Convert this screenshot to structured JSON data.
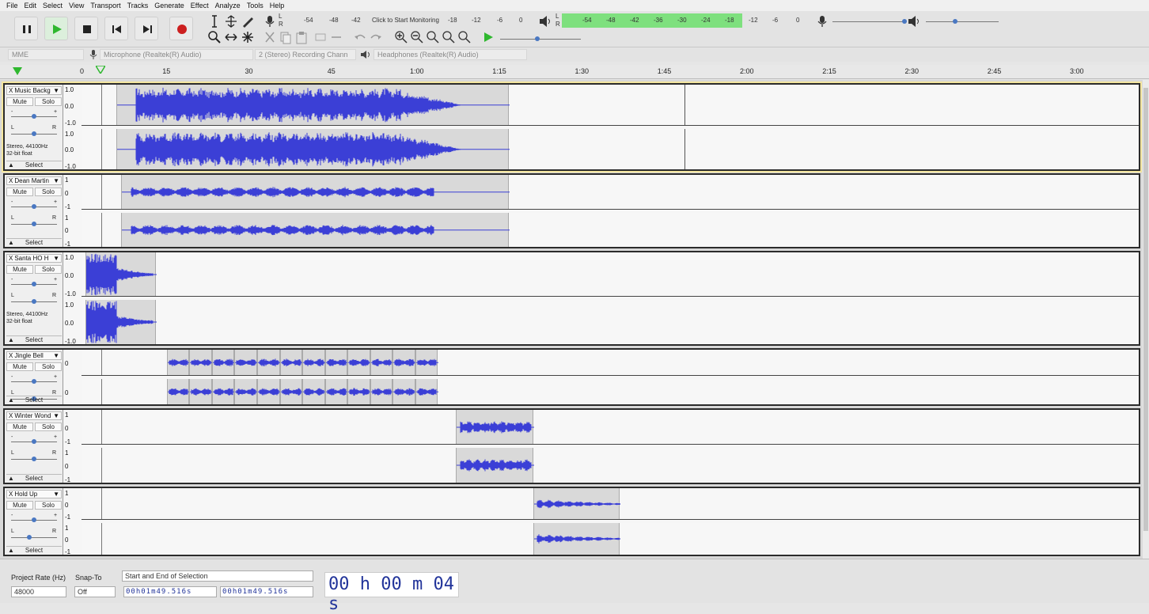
{
  "menus": [
    "File",
    "Edit",
    "Select",
    "View",
    "Transport",
    "Tracks",
    "Generate",
    "Effect",
    "Analyze",
    "Tools",
    "Help"
  ],
  "transport": {
    "pause": "pause-icon",
    "play": "play-icon",
    "stop": "stop-icon",
    "skip_start": "skip-start-icon",
    "skip_end": "skip-end-icon",
    "record": "record-icon"
  },
  "meters": {
    "record_ticks": [
      "-54",
      "-48",
      "-42",
      "Click to Start Monitoring",
      "-18",
      "-12",
      "-6",
      "0"
    ],
    "play_ticks": [
      "-54",
      "-48",
      "-42",
      "-36",
      "-30",
      "-24",
      "-18",
      "-12",
      "-6",
      "0"
    ],
    "channel_l": "L",
    "channel_r": "R"
  },
  "devices": {
    "host": "MME",
    "mic": "Microphone (Realtek(R) Audio)",
    "channels": "2 (Stereo) Recording Chann",
    "speakers": "Headphones (Realtek(R) Audio)"
  },
  "ruler": {
    "ticks": [
      "0",
      "15",
      "30",
      "45",
      "1:00",
      "1:15",
      "1:30",
      "1:45",
      "2:00",
      "2:15",
      "2:30",
      "2:45",
      "3:00"
    ]
  },
  "track_controls": {
    "mute": "Mute",
    "solo": "Solo",
    "select": "Select",
    "close": "X",
    "pan_left": "L",
    "pan_right": "R",
    "gain_minus": "-",
    "gain_plus": "+"
  },
  "tracks": [
    {
      "name": "Music Backg",
      "info1": "Stereo, 44100Hz",
      "info2": "32-bit float",
      "scale": [
        "1.0",
        "0.0",
        "-1.0"
      ]
    },
    {
      "name": "Dean Martin",
      "info1": "",
      "info2": "",
      "scale": [
        "1",
        "0",
        "-1"
      ]
    },
    {
      "name": "Santa HO H",
      "info1": "Stereo, 44100Hz",
      "info2": "32-bit float",
      "scale": [
        "1.0",
        "0.0",
        "-1.0"
      ]
    },
    {
      "name": "Jingle Bell",
      "info1": "",
      "info2": "",
      "scale": [
        "",
        "0",
        ""
      ]
    },
    {
      "name": "Winter Wond",
      "info1": "",
      "info2": "",
      "scale": [
        "1",
        "0",
        "-1"
      ]
    },
    {
      "name": "Hold Up",
      "info1": "",
      "info2": "",
      "scale": [
        "1",
        "0",
        "-1"
      ]
    }
  ],
  "bottom": {
    "project_rate_label": "Project Rate (Hz)",
    "project_rate": "48000",
    "snap_label": "Snap-To",
    "snap": "Off",
    "selection_mode": "Start and End of Selection",
    "sel_start": "00h01m49.516s",
    "sel_end": "00h01m49.516s",
    "position": "00 h 00 m 04 s"
  },
  "colors": {
    "waveform": "#3b3fd6",
    "clip_bg": "#d9d9d9",
    "meter_green": "#7ee07e",
    "selected_border": "#f4e6a0",
    "play": "#2fb82f",
    "record": "#cc1f1f"
  }
}
